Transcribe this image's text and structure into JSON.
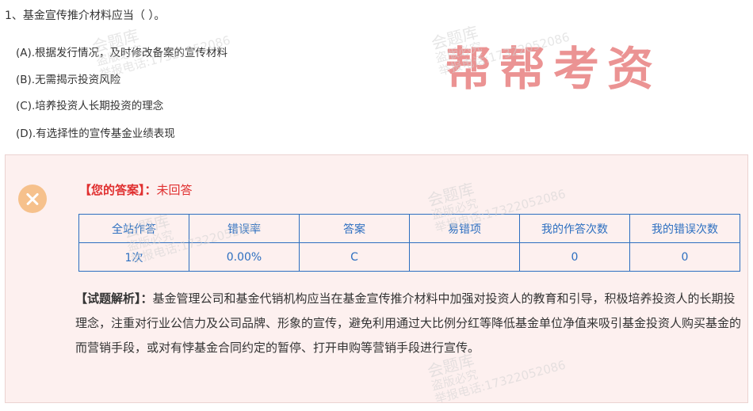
{
  "question": {
    "title": "1、基金宣传推介材料应当（ ）。",
    "options": [
      {
        "label": "(A).根据发行情况，及时修改备案的宣传材料"
      },
      {
        "label": "(B).无需揭示投资风险"
      },
      {
        "label": "(C).培养投资人长期投资的理念"
      },
      {
        "label": "(D).有选择性的宣传基金业绩表现"
      }
    ]
  },
  "brand": "帮帮考资",
  "watermark": {
    "line1": "会题库",
    "line2": "盗版必究",
    "line3": "举报电话:17322052086"
  },
  "result": {
    "status_icon": "close-icon",
    "your_answer_label": "【您的答案】：",
    "your_answer_value": "未回答",
    "stats": {
      "headers": [
        "全站作答",
        "错误率",
        "答案",
        "易错项",
        "我的作答次数",
        "我的错误次数"
      ],
      "values": [
        "1次",
        "0.00%",
        "C",
        "",
        "0",
        "0"
      ]
    },
    "analysis_label": "【试题解析】：",
    "analysis_text": "基金管理公司和基金代销机构应当在基金宣传推介材料中加强对投资人的教育和引导，积极培养投资人的长期投理念，注重对行业公信力及公司品牌、形象的宣传，避免利用通过大比例分红等降低基金单位净值来吸引基金投资人购买基金的而营销手段，或对有悖基金合同约定的暂停、打开申购等营销手段进行宣传。"
  },
  "colors": {
    "accent_blue": "#2d6fc0",
    "error_red": "#e02f2f",
    "brand_pink": "#e98585",
    "panel_bg": "#fdf0ef",
    "icon_orange": "#f6c18c"
  }
}
